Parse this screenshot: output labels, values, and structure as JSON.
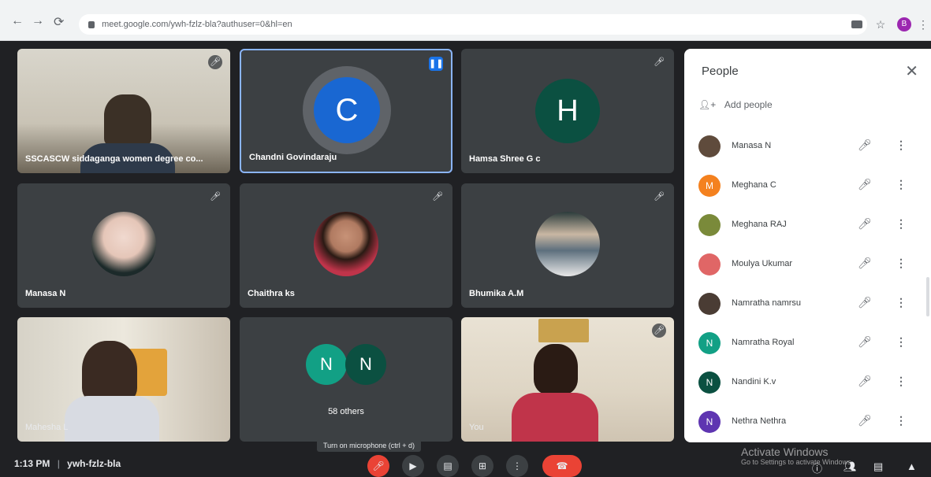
{
  "browser": {
    "url": "meet.google.com/ywh-fzlz-bla?authuser=0&hl=en",
    "avatar_letter": "B"
  },
  "tiles": [
    {
      "name": "SSCASCW siddaganga women degree co...",
      "kind": "video"
    },
    {
      "name": "Chandni Govindaraju",
      "kind": "avatar",
      "letter": "C",
      "color": "#1967d2",
      "active": true
    },
    {
      "name": "Hamsa Shree G c",
      "kind": "avatar",
      "letter": "H",
      "color": "#0b5041"
    },
    {
      "name": "Manasa N",
      "kind": "photo"
    },
    {
      "name": "Chaithra ks",
      "kind": "photo"
    },
    {
      "name": "Bhumika A.M",
      "kind": "photo"
    },
    {
      "name": "Mahesha L",
      "kind": "video"
    },
    {
      "name": "58 others",
      "kind": "others",
      "letters": [
        "N",
        "N"
      ]
    },
    {
      "name": "You",
      "kind": "video"
    }
  ],
  "people_panel": {
    "title": "People",
    "add_label": "Add people",
    "list": [
      {
        "name": "Manasa N",
        "initial": "",
        "color": "#5f4b3c"
      },
      {
        "name": "Meghana C",
        "initial": "M",
        "color": "#f4811f"
      },
      {
        "name": "Meghana RAJ",
        "initial": "",
        "color": "#7a8a3a"
      },
      {
        "name": "Moulya Ukumar",
        "initial": "",
        "color": "#e06666"
      },
      {
        "name": "Namratha namrsu",
        "initial": "",
        "color": "#4a3c34"
      },
      {
        "name": "Namratha Royal",
        "initial": "N",
        "color": "#12a085"
      },
      {
        "name": "Nandini K.v",
        "initial": "N",
        "color": "#0b5041"
      },
      {
        "name": "Nethra Nethra",
        "initial": "N",
        "color": "#5e35b1"
      }
    ]
  },
  "bottom": {
    "time": "1:13 PM",
    "separator": "|",
    "meeting_code": "ywh-fzlz-bla",
    "tooltip": "Turn on microphone (ctrl + d)"
  },
  "watermark": {
    "line1": "Activate Windows",
    "line2": "Go to Settings to activate Windows."
  },
  "colors": {
    "accent": "#8ab4f8",
    "danger": "#ea4335",
    "tile": "#3c4043",
    "background": "#202124"
  }
}
